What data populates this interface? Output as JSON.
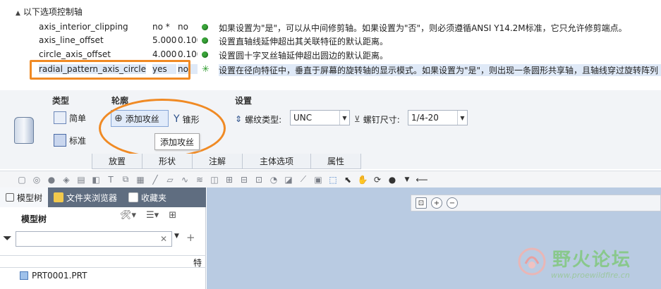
{
  "options": {
    "header": "以下选项控制轴",
    "rows": [
      {
        "name": "axis_interior_clipping",
        "value": "no *",
        "default": "no",
        "indicator": "dot",
        "desc": "如果设置为\"是\"，可以从中间修剪轴。如果设置为\"否\"，则必须遵循ANSI Y14.2M标准，它只允许修剪端点。"
      },
      {
        "name": "axis_line_offset",
        "value": "5.0000",
        "default": "0.100",
        "indicator": "dot",
        "desc": "设置直轴线延伸超出其关联特征的默认距离。"
      },
      {
        "name": "circle_axis_offset",
        "value": "4.0000",
        "default": "0.100",
        "indicator": "dot",
        "desc": "设置圆十字叉丝轴延伸超出圆边的默认距离。"
      },
      {
        "name": "radial_pattern_axis_circle",
        "value": "yes",
        "default": "no",
        "indicator": "star",
        "desc": "设置在径向特征中，垂直于屏幕的旋转轴的显示模式。如果设置为\"是\"，则出现一条圆形共享轴，且轴线穿过旋转阵列"
      }
    ]
  },
  "ribbon": {
    "group_type": "类型",
    "group_profile": "轮廓",
    "group_settings": "设置",
    "simple_label": "简单",
    "standard_label": "标准",
    "add_tap_label": "添加攻丝",
    "taper_label": "锥形",
    "thread_type_label": "螺纹类型:",
    "thread_type_value": "UNC",
    "screw_size_label": "螺钉尺寸:",
    "screw_size_value": "1/4-20",
    "tooltip": "添加攻丝",
    "tabs": [
      "放置",
      "形状",
      "注解",
      "主体选项",
      "属性"
    ]
  },
  "panel": {
    "tabs": [
      "模型树",
      "文件夹浏览器",
      "收藏夹"
    ],
    "title": "模型树",
    "col_header": "特",
    "part_name": "PRT0001.PRT"
  },
  "watermark": {
    "text": "野火论坛",
    "url": "www.proewildfire.cn"
  },
  "colors": {
    "highlight": "#f08a24",
    "selection": "#dfe9f7",
    "panel_tabs": "#5f6d80",
    "graphics_bg": "#b9cbe2"
  }
}
